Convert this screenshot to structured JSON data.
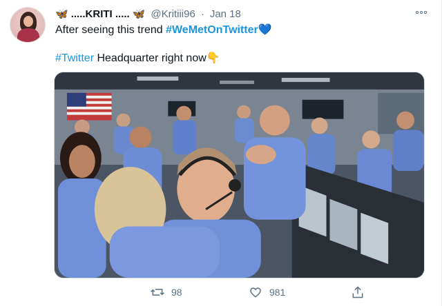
{
  "tweet": {
    "display_name_prefix_icon": "blue-butterfly-icon",
    "display_name": ".....KRITI .....",
    "display_name_suffix_icon": "blue-butterfly-icon",
    "handle": "@Kritiii96",
    "separator": "·",
    "date": "Jan 18",
    "line1_text": "After seeing this trend ",
    "line1_hashtag": "#WeMetOnTwitter",
    "line1_emoji": "💙",
    "line2_hashtag": "#Twitter",
    "line2_text": " Headquarter right now",
    "line2_emoji": "👇"
  },
  "actions": {
    "retweet_count": "98",
    "like_count": "981"
  },
  "colors": {
    "accent": "#1b95e0",
    "muted": "#5b7083"
  }
}
